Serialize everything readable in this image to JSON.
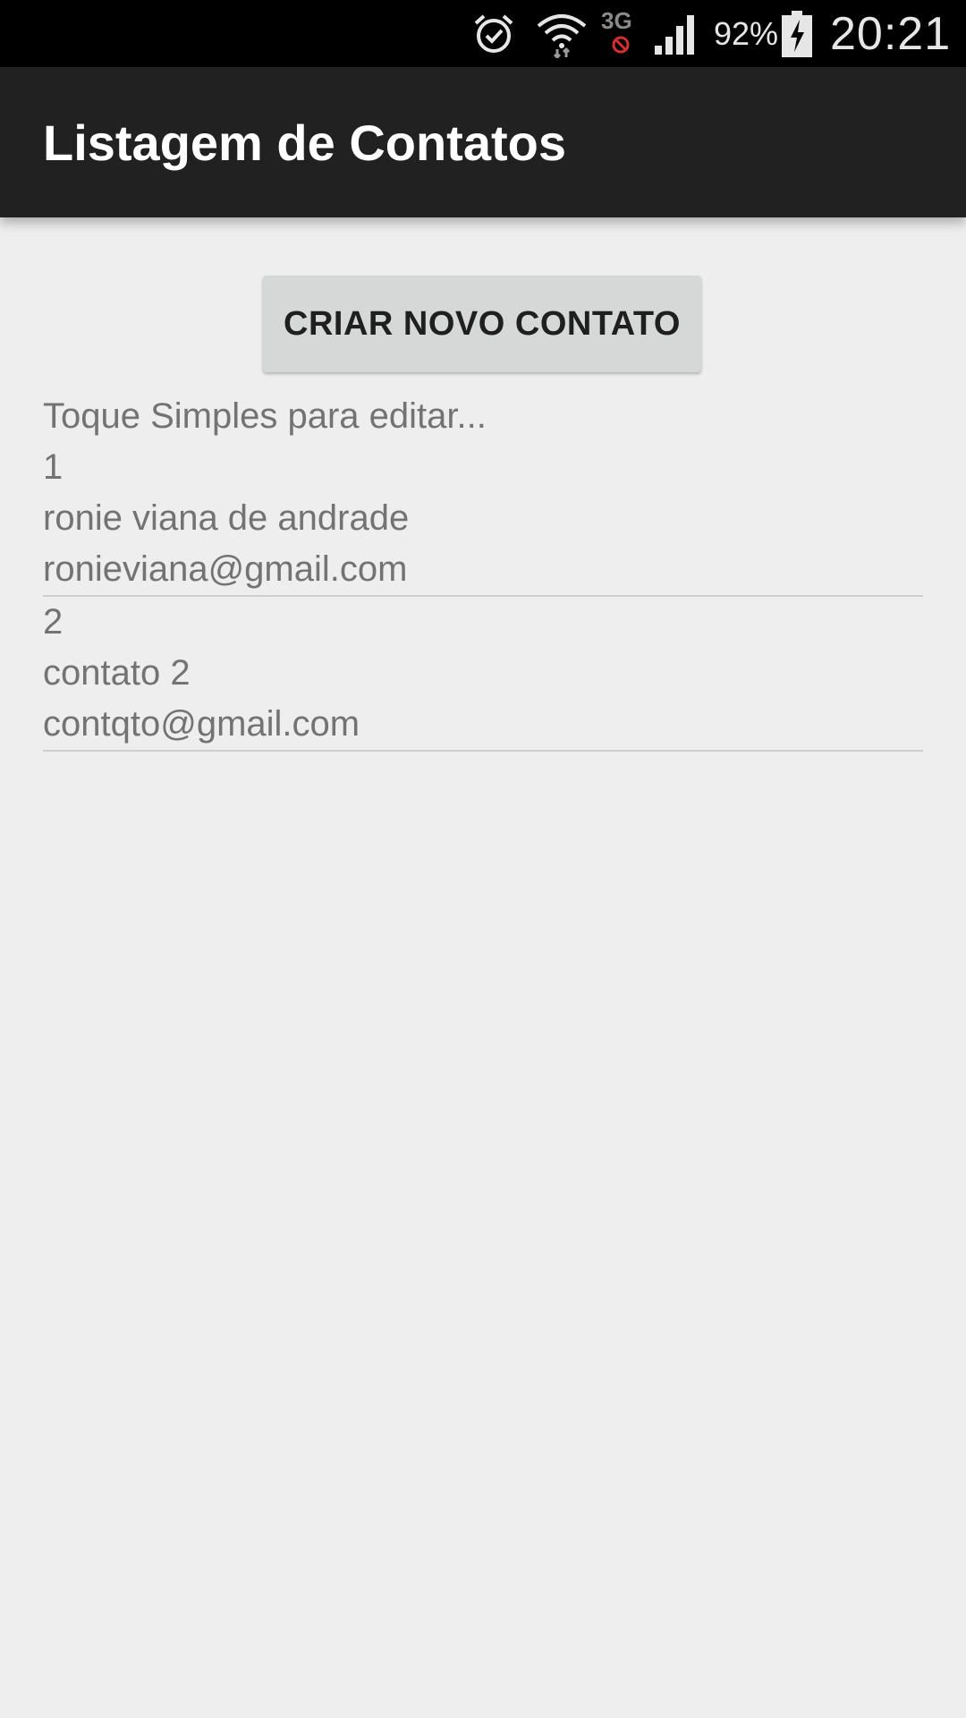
{
  "status_bar": {
    "battery_pct": "92%",
    "time": "20:21",
    "network_label": "3G",
    "icons": [
      "alarm-icon",
      "wifi-icon",
      "3g-icon",
      "signal-icon",
      "battery-icon"
    ]
  },
  "app_bar": {
    "title": "Listagem de Contatos",
    "color": "#212121"
  },
  "actions": {
    "create_label": "CRIAR NOVO CONTATO"
  },
  "hint": "Toque Simples para editar...",
  "contacts": [
    {
      "id": "1",
      "name": "ronie viana de andrade",
      "email": "ronieviana@gmail.com"
    },
    {
      "id": "2",
      "name": "contato 2",
      "email": "contqto@gmail.com"
    }
  ]
}
